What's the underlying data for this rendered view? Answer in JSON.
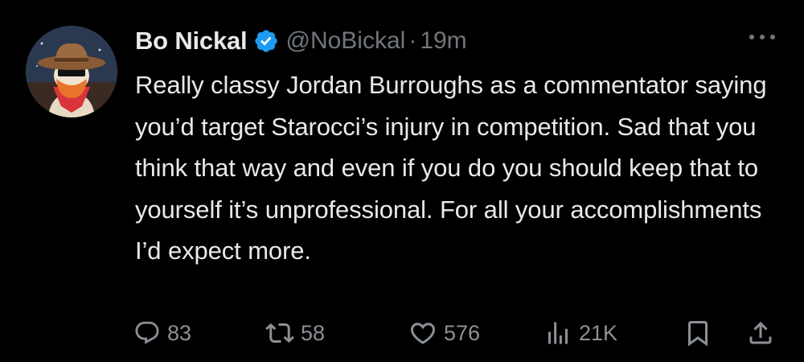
{
  "tweet": {
    "display_name": "Bo Nickal",
    "handle": "@NoBickal",
    "separator": "·",
    "time": "19m",
    "text": "Really classy Jordan Burroughs as a commentator saying you’d target Starocci’s injury in competition. Sad that you think that way and even if you do you should keep that to yourself it’s unprofessional. For all your accomplishments I’d expect more.",
    "verified_color": "#1d9bf0"
  },
  "actions": {
    "reply": {
      "icon": "reply-icon",
      "count": "83"
    },
    "retweet": {
      "icon": "retweet-icon",
      "count": "58"
    },
    "like": {
      "icon": "heart-icon",
      "count": "576"
    },
    "views": {
      "icon": "views-icon",
      "count": "21K"
    },
    "bookmark": {
      "icon": "bookmark-icon"
    },
    "share": {
      "icon": "share-icon"
    }
  },
  "colors": {
    "background": "#000000",
    "text": "#e7e9ea",
    "secondary": "#71767b",
    "accent": "#1d9bf0"
  }
}
